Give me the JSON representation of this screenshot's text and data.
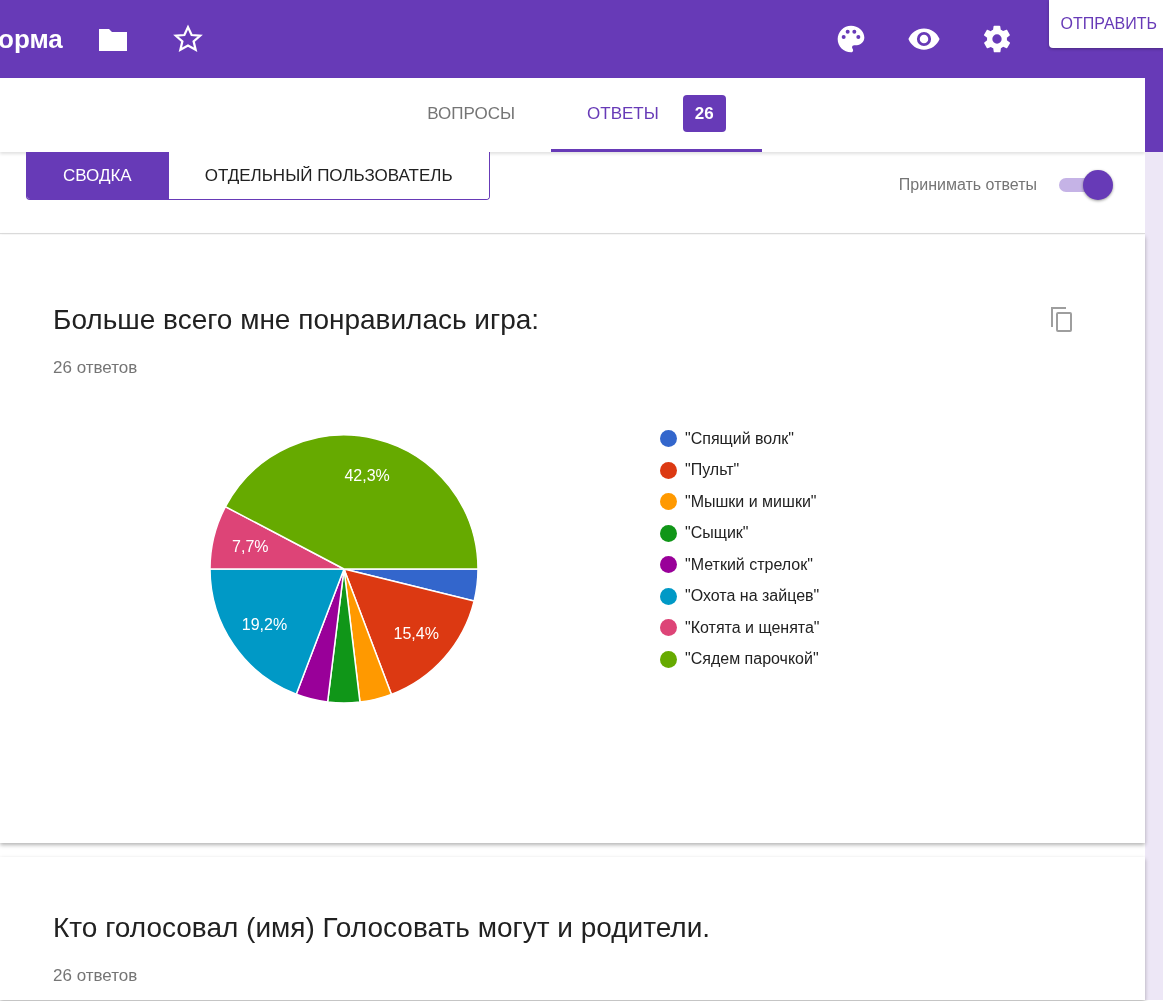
{
  "header": {
    "title": "орма",
    "send_button": "ОТПРАВИТЬ"
  },
  "tabs": [
    {
      "label": "ВОПРОСЫ",
      "selected": false
    },
    {
      "label": "ОТВЕТЫ",
      "selected": true,
      "badge": "26"
    }
  ],
  "view_toggle": [
    {
      "label": "СВОДКА",
      "selected": true
    },
    {
      "label": "ОТДЕЛЬНЫЙ ПОЛЬЗОВАТЕЛЬ",
      "selected": false
    }
  ],
  "accept_responses": {
    "label": "Принимать ответы",
    "on": true
  },
  "questions": [
    {
      "title": "Больше всего мне понравилась игра:",
      "count": "26 ответов",
      "chart_data": {
        "type": "pie",
        "categories": [
          "\"Спящий волк\"",
          "\"Пульт\"",
          "\"Мышки и мишки\"",
          "\"Сыщик\"",
          "\"Меткий стрелок\"",
          "\"Охота на зайцев\"",
          "\"Котята и щенята\"",
          "\"Сядем парочкой\""
        ],
        "values": [
          3.85,
          15.4,
          3.85,
          3.85,
          3.85,
          19.2,
          7.7,
          42.3
        ],
        "colors": [
          "#3366cc",
          "#dc3912",
          "#ff9900",
          "#109618",
          "#990099",
          "#0099c6",
          "#dd4477",
          "#66aa00"
        ],
        "value_labels": [
          null,
          "15,4%",
          null,
          null,
          null,
          "19,2%",
          "7,7%",
          "42,3%"
        ]
      }
    },
    {
      "title": "Кто голосовал (имя) Голосовать могут и родители.",
      "count": "26 ответов"
    }
  ]
}
